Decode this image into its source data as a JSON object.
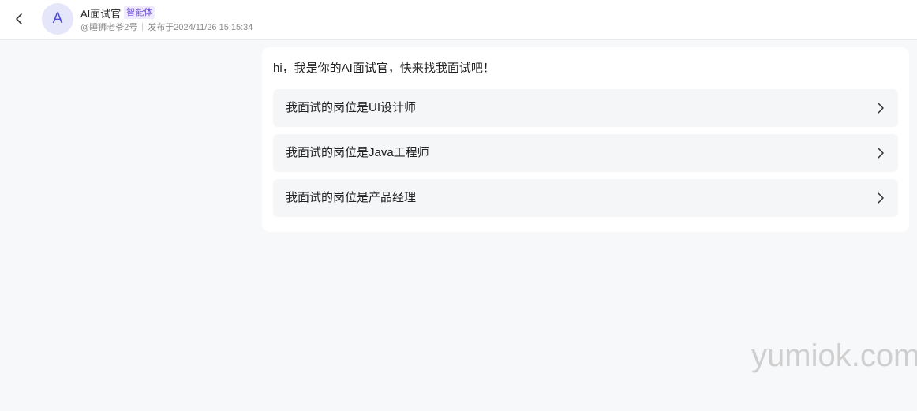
{
  "header": {
    "back_icon": "chevron-left-icon",
    "avatar_letter": "A",
    "agent_name": "AI面试官",
    "agent_badge": "智能体",
    "author": "@睡狮老爷2号",
    "published": "发布于2024/11/26 15:15:34"
  },
  "chat": {
    "greeting": "hi，我是你的AI面试官，快来找我面试吧！",
    "options": [
      {
        "label": "我面试的岗位是UI设计师",
        "icon": "chevron-right-icon"
      },
      {
        "label": "我面试的岗位是Java工程师",
        "icon": "chevron-right-icon"
      },
      {
        "label": "我面试的岗位是产品经理",
        "icon": "chevron-right-icon"
      }
    ]
  },
  "watermark": "yumiok.com",
  "colors": {
    "background": "#f7f8fa",
    "avatar_bg": "#e6e6fb",
    "avatar_fg": "#4b4bd6",
    "badge_fg": "#6b4dd6",
    "badge_bg": "#efeafd",
    "option_bg": "#f5f6f8"
  }
}
